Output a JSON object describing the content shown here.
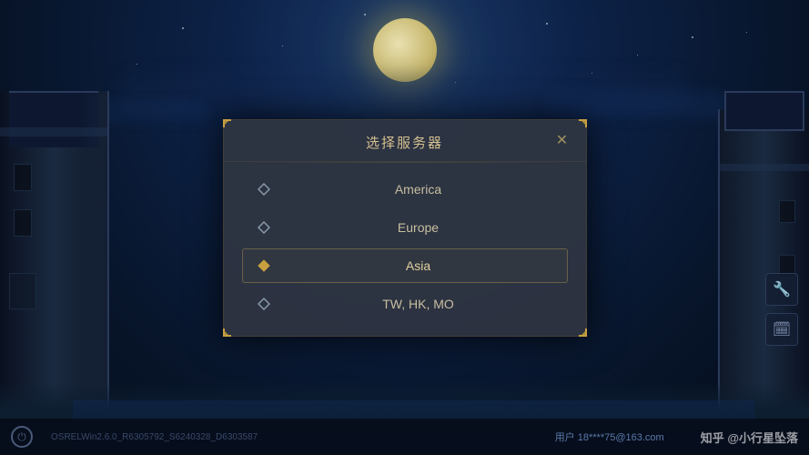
{
  "background": {
    "moon_visible": true
  },
  "dialog": {
    "title": "选择服务器",
    "close_label": "✕"
  },
  "servers": [
    {
      "id": "america",
      "label": "America",
      "selected": false
    },
    {
      "id": "europe",
      "label": "Europe",
      "selected": false
    },
    {
      "id": "asia",
      "label": "Asia",
      "selected": true
    },
    {
      "id": "twhkmo",
      "label": "TW, HK, MO",
      "selected": false
    }
  ],
  "tools": [
    {
      "id": "wrench",
      "icon": "🔧"
    },
    {
      "id": "calendar",
      "icon": "📅"
    }
  ],
  "bottom_bar": {
    "version": "OSRELWin2.6.0_R6305792_S6240328_D6303587",
    "user": "用户 18****75@163.com",
    "watermark": "知乎 @小行星坠落"
  },
  "corners": {
    "color": "#c8a040"
  }
}
